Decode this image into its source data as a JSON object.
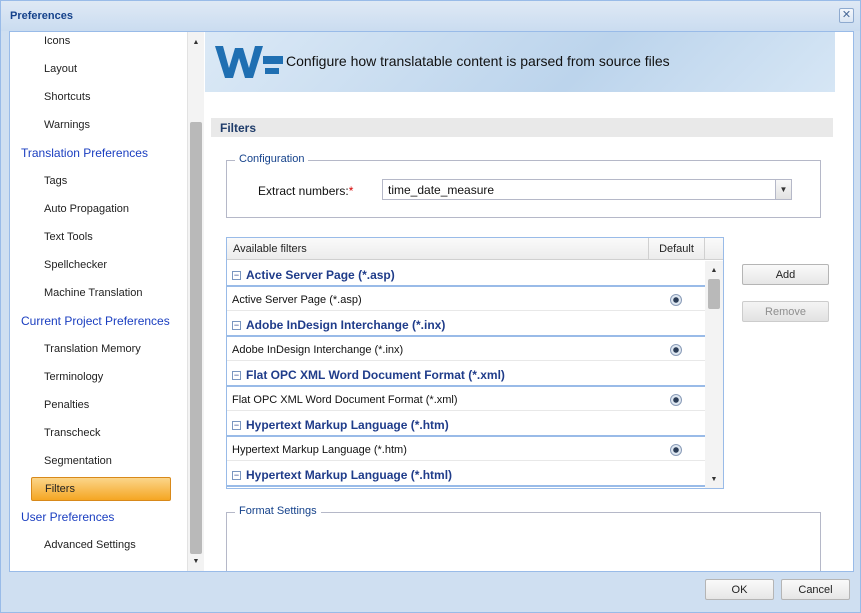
{
  "window": {
    "title": "Preferences"
  },
  "sidebar": {
    "items": [
      {
        "label": "Icons",
        "level": "child"
      },
      {
        "label": "Layout",
        "level": "child"
      },
      {
        "label": "Shortcuts",
        "level": "child"
      },
      {
        "label": "Warnings",
        "level": "child"
      },
      {
        "label": "Translation Preferences",
        "level": "group"
      },
      {
        "label": "Tags",
        "level": "child"
      },
      {
        "label": "Auto Propagation",
        "level": "child"
      },
      {
        "label": "Text Tools",
        "level": "child"
      },
      {
        "label": "Spellchecker",
        "level": "child"
      },
      {
        "label": "Machine Translation",
        "level": "child"
      },
      {
        "label": "Current Project Preferences",
        "level": "group"
      },
      {
        "label": "Translation Memory",
        "level": "child"
      },
      {
        "label": "Terminology",
        "level": "child"
      },
      {
        "label": "Penalties",
        "level": "child"
      },
      {
        "label": "Transcheck",
        "level": "child"
      },
      {
        "label": "Segmentation",
        "level": "child"
      },
      {
        "label": "Filters",
        "level": "child",
        "selected": true
      },
      {
        "label": "User Preferences",
        "level": "group"
      },
      {
        "label": "Advanced Settings",
        "level": "child"
      }
    ]
  },
  "header": {
    "text": "Configure how translatable content is parsed from source files"
  },
  "section": {
    "title": "Filters"
  },
  "configuration": {
    "legend": "Configuration",
    "extract_label": "Extract numbers:",
    "required_mark": "*",
    "extract_value": "time_date_measure"
  },
  "grid": {
    "columns": [
      "Available filters",
      "Default"
    ],
    "groups": [
      {
        "name": "Active Server Page (*.asp)",
        "row": "Active Server Page (*.asp)",
        "toggle": "−"
      },
      {
        "name": "Adobe InDesign Interchange (*.inx)",
        "row": "Adobe InDesign Interchange (*.inx)",
        "toggle": "−"
      },
      {
        "name": "Flat OPC XML Word Document Format (*.xml)",
        "row": "Flat OPC XML Word Document Format (*.xml)",
        "toggle": "−"
      },
      {
        "name": "Hypertext Markup Language (*.htm)",
        "row": "Hypertext Markup Language (*.htm)",
        "toggle": "−"
      },
      {
        "name": "Hypertext Markup Language (*.html)",
        "toggle": "−"
      }
    ]
  },
  "buttons": {
    "add": "Add",
    "remove": "Remove",
    "ok": "OK",
    "cancel": "Cancel"
  },
  "format_settings": {
    "legend": "Format Settings"
  },
  "icons": {
    "close": "✕",
    "up": "▲",
    "down": "▼"
  },
  "colors": {
    "selected_bg": "#f5a623",
    "group_text": "#1a3ec0",
    "title_text": "#15428b"
  }
}
